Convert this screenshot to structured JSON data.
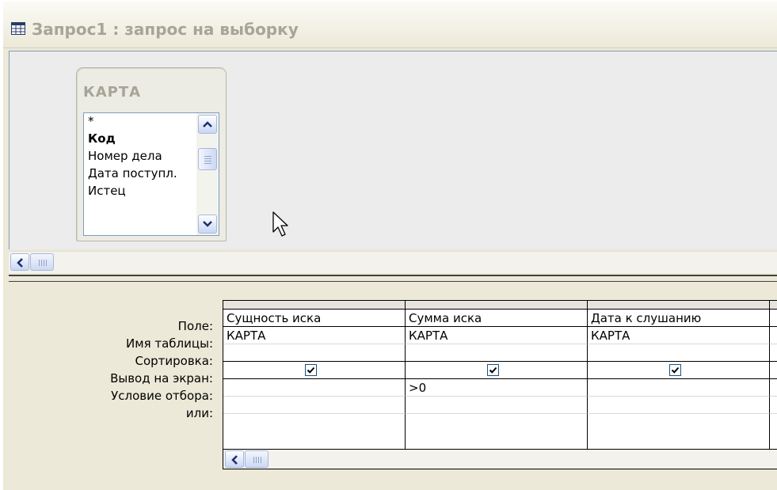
{
  "window": {
    "title": "Запрос1 : запрос на выборку"
  },
  "table": {
    "name": "КАРТА",
    "fields": [
      {
        "label": "*",
        "bold": false
      },
      {
        "label": "Код",
        "bold": true
      },
      {
        "label": "Номер дела",
        "bold": false
      },
      {
        "label": "Дата поступл.",
        "bold": false
      },
      {
        "label": "Истец",
        "bold": false
      }
    ]
  },
  "grid": {
    "row_labels": {
      "field": "Поле:",
      "table": "Имя таблицы:",
      "sort": "Сортировка:",
      "show": "Вывод на экран:",
      "criteria": "Условие отбора:",
      "or": "или:"
    },
    "columns": [
      {
        "field": "Сущность иска",
        "table": "КАРТА",
        "sort": "",
        "show": true,
        "criteria": "",
        "or": ""
      },
      {
        "field": "Сумма иска",
        "table": "КАРТА",
        "sort": "",
        "show": true,
        "criteria": ">0",
        "or": ""
      },
      {
        "field": "Дата к слушанию",
        "table": "КАРТА",
        "sort": "",
        "show": true,
        "criteria": "",
        "or": ""
      }
    ]
  },
  "colors": {
    "inactive_title": "#a7a498",
    "checkbox_border": "#1c5180",
    "window_bg": "#ece9d8"
  }
}
